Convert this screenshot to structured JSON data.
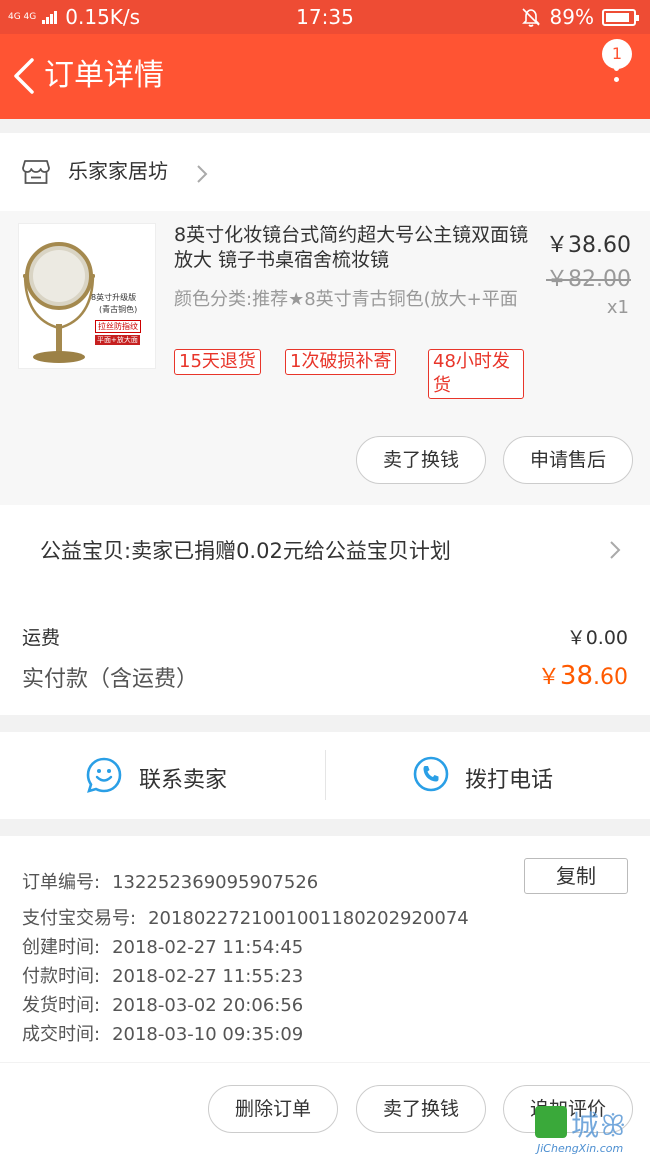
{
  "status_bar": {
    "network": "4G 4G",
    "speed": "0.15K/s",
    "time": "17:35",
    "battery": "89%",
    "battery_level": 0.89
  },
  "header": {
    "title": "订单详情",
    "badge_count": "1"
  },
  "shop": {
    "name": "乐家家居坊"
  },
  "product": {
    "title": "8英寸化妆镜台式简约超大号公主镜双面镜放大 镜子书桌宿舍梳妆镜",
    "sku": "颜色分类:推荐★8英寸青古铜色(放大+平面",
    "price": "￥38.60",
    "original_price": "￥82.00",
    "quantity": "x1",
    "image_labels": {
      "line1": "8英寸升级版",
      "line2": "(青古铜色)",
      "line3": "拉丝防指纹",
      "line4": "平面+放大面"
    },
    "services": [
      "15天退货",
      "1次破损补寄",
      "48小时发货"
    ],
    "actions": {
      "sell": "卖了换钱",
      "after_sale": "申请售后"
    }
  },
  "charity": {
    "text": "公益宝贝:卖家已捐赠0.02元给公益宝贝计划"
  },
  "totals": {
    "shipping_label": "运费",
    "shipping_value": "￥0.00",
    "paid_label": "实付款（含运费）",
    "paid_currency": "￥",
    "paid_integer": "38",
    "paid_decimal": ".60"
  },
  "contact": {
    "seller": "联系卖家",
    "phone": "拨打电话"
  },
  "order_info": {
    "order_no_label": "订单编号:",
    "order_no": "1322523690959075­26",
    "copy_label": "复制",
    "alipay_label": "支付宝交易号:",
    "alipay_no": "20180227210010011802029200­74",
    "created_label": "创建时间:",
    "created": "2018-02-27 11:54:45",
    "paid_label": "付款时间:",
    "paid": "2018-02-27 11:55:23",
    "shipped_label": "发货时间:",
    "shipped": "2018-03-02 20:06:56",
    "completed_label": "成交时间:",
    "completed": "2018-03-10 09:35:09"
  },
  "footer": {
    "delete": "删除订单",
    "sell": "卖了换钱",
    "review": "追加评价"
  },
  "watermark": {
    "text": "城ꕥ",
    "sub": "JiChengXin.com"
  },
  "colors": {
    "brand": "#ff5433",
    "price_orange": "#ff5a00",
    "service_red": "#e8352a",
    "icon_blue": "#2a9fe6"
  }
}
